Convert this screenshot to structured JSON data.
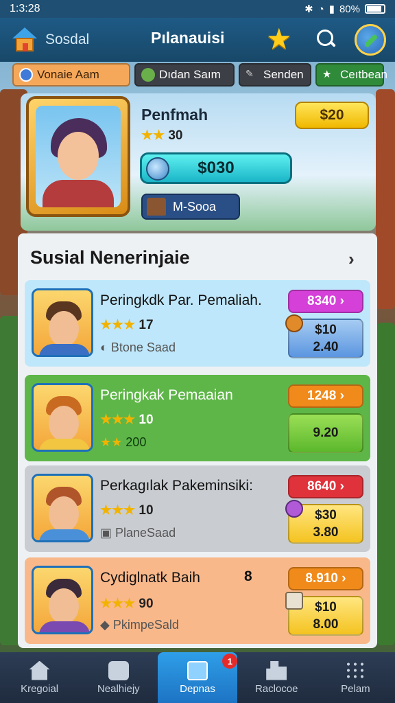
{
  "statusbar": {
    "time": "1:3:28",
    "battery": "80%"
  },
  "header": {
    "left_label": "Sosdal",
    "title": "Pılanauisi"
  },
  "tabs": [
    {
      "label": "Vonaie Aam"
    },
    {
      "label": "Dıdan Saım"
    },
    {
      "label": "Senden"
    },
    {
      "label": "Ceıtbean"
    }
  ],
  "profile": {
    "name": "Penfmah",
    "stars": "30",
    "gold": "$20",
    "coins": "$030",
    "mode": "M-Sooa"
  },
  "panel": {
    "title": "Susial Nenerinjaie",
    "rows": [
      {
        "name": "Peringkdk Par. Pemaliah.",
        "stars": "17",
        "sub": "Btone Saad",
        "chip": "8340",
        "box_top": "$10",
        "box_bottom": "2.40",
        "extra": ""
      },
      {
        "name": "Peringkak Pemaaian",
        "stars": "10",
        "sub": "200",
        "chip": "1248",
        "box_top": "",
        "box_bottom": "9.20",
        "extra": ""
      },
      {
        "name": "Perkagılak Pakeminsiki:",
        "stars": "10",
        "sub": "PlaneSaad",
        "chip": "8640",
        "box_top": "$30",
        "box_bottom": "3.80",
        "extra": ""
      },
      {
        "name": "Cydiglnatk Baih",
        "stars": "90",
        "sub": "PkimpeSald",
        "chip": "8.910",
        "box_top": "$10",
        "box_bottom": "8.00",
        "extra": "8"
      }
    ]
  },
  "nav": [
    {
      "label": "Kregoial"
    },
    {
      "label": "Nealhiejy"
    },
    {
      "label": "Depnas",
      "badge": "1"
    },
    {
      "label": "Raclocoe"
    },
    {
      "label": "Pelam"
    }
  ]
}
